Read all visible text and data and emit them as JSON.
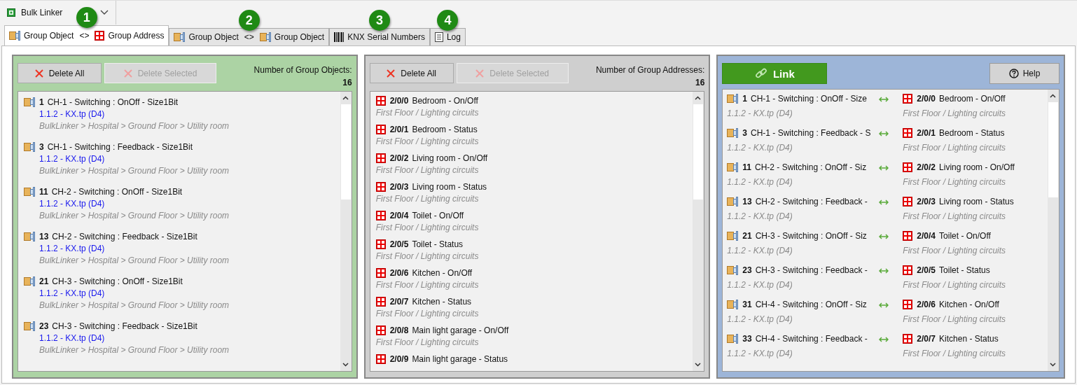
{
  "app_selector": {
    "label": "Bulk Linker"
  },
  "tabs": [
    {
      "selected": true,
      "badge": "1",
      "parts": [
        {
          "kind": "object",
          "text": "Group Object"
        },
        {
          "kind": "separator",
          "text": "<>"
        },
        {
          "kind": "address",
          "text": "Group Address"
        }
      ]
    },
    {
      "selected": false,
      "badge": "2",
      "parts": [
        {
          "kind": "object",
          "text": "Group Object"
        },
        {
          "kind": "separator",
          "text": "<>"
        },
        {
          "kind": "object",
          "text": "Group Object"
        }
      ]
    },
    {
      "selected": false,
      "badge": "3",
      "parts": [
        {
          "kind": "barcode",
          "text": "KNX Serial Numbers"
        }
      ]
    },
    {
      "selected": false,
      "badge": "4",
      "parts": [
        {
          "kind": "log",
          "text": "Log"
        }
      ]
    }
  ],
  "group_objects": {
    "buttons": [
      {
        "label": "Delete All",
        "disabled": false
      },
      {
        "label": "Delete Selected",
        "disabled": true
      }
    ],
    "count_label": "Number of Group Objects:",
    "count": "16",
    "items": [
      {
        "number": "1",
        "name": "CH-1 - Switching : OnOff - Size1Bit",
        "device": "1.1.2 - KX.tp (D4)",
        "path": "BulkLinker > Hospital > Ground Floor > Utility room"
      },
      {
        "number": "3",
        "name": "CH-1 - Switching : Feedback - Size1Bit",
        "device": "1.1.2 - KX.tp (D4)",
        "path": "BulkLinker > Hospital > Ground Floor > Utility room"
      },
      {
        "number": "11",
        "name": "CH-2 - Switching : OnOff - Size1Bit",
        "device": "1.1.2 - KX.tp (D4)",
        "path": "BulkLinker > Hospital > Ground Floor > Utility room"
      },
      {
        "number": "13",
        "name": "CH-2 - Switching : Feedback - Size1Bit",
        "device": "1.1.2 - KX.tp (D4)",
        "path": "BulkLinker > Hospital > Ground Floor > Utility room"
      },
      {
        "number": "21",
        "name": "CH-3 - Switching : OnOff - Size1Bit",
        "device": "1.1.2 - KX.tp (D4)",
        "path": "BulkLinker > Hospital > Ground Floor > Utility room"
      },
      {
        "number": "23",
        "name": "CH-3 - Switching : Feedback - Size1Bit",
        "device": "1.1.2 - KX.tp (D4)",
        "path": "BulkLinker > Hospital > Ground Floor > Utility room"
      }
    ]
  },
  "group_addresses": {
    "buttons": [
      {
        "label": "Delete All",
        "disabled": false
      },
      {
        "label": "Delete Selected",
        "disabled": true
      }
    ],
    "count_label": "Number of Group Addresses:",
    "count": "16",
    "items": [
      {
        "address": "2/0/0",
        "name": "Bedroom - On/Off",
        "path": "First Floor / Lighting circuits"
      },
      {
        "address": "2/0/1",
        "name": "Bedroom - Status",
        "path": "First Floor / Lighting circuits"
      },
      {
        "address": "2/0/2",
        "name": "Living room - On/Off",
        "path": "First Floor / Lighting circuits"
      },
      {
        "address": "2/0/3",
        "name": "Living room - Status",
        "path": "First Floor / Lighting circuits"
      },
      {
        "address": "2/0/4",
        "name": "Toilet - On/Off",
        "path": "First Floor / Lighting circuits"
      },
      {
        "address": "2/0/5",
        "name": "Toilet - Status",
        "path": "First Floor / Lighting circuits"
      },
      {
        "address": "2/0/6",
        "name": "Kitchen - On/Off",
        "path": "First Floor / Lighting circuits"
      },
      {
        "address": "2/0/7",
        "name": "Kitchen - Status",
        "path": "First Floor / Lighting circuits"
      },
      {
        "address": "2/0/8",
        "name": "Main light garage - On/Off",
        "path": "First Floor / Lighting circuits"
      },
      {
        "address": "2/0/9",
        "name": "Main light garage - Status"
      }
    ]
  },
  "links": {
    "link_button": "Link",
    "help_button": "Help",
    "items": [
      {
        "number": "1",
        "name": "CH-1 - Switching : OnOff - Size",
        "device": "1.1.2 - KX.tp (D4)",
        "address": "2/0/0",
        "ga_name": "Bedroom - On/Off",
        "path": "First Floor / Lighting circuits"
      },
      {
        "number": "3",
        "name": "CH-1 - Switching : Feedback - S",
        "device": "1.1.2 - KX.tp (D4)",
        "address": "2/0/1",
        "ga_name": "Bedroom - Status",
        "path": "First Floor / Lighting circuits"
      },
      {
        "number": "11",
        "name": "CH-2 - Switching : OnOff - Siz",
        "device": "1.1.2 - KX.tp (D4)",
        "address": "2/0/2",
        "ga_name": "Living room - On/Off",
        "path": "First Floor / Lighting circuits"
      },
      {
        "number": "13",
        "name": "CH-2 - Switching : Feedback -",
        "device": "1.1.2 - KX.tp (D4)",
        "address": "2/0/3",
        "ga_name": "Living room - Status",
        "path": "First Floor / Lighting circuits"
      },
      {
        "number": "21",
        "name": "CH-3 - Switching : OnOff - Siz",
        "device": "1.1.2 - KX.tp (D4)",
        "address": "2/0/4",
        "ga_name": "Toilet - On/Off",
        "path": "First Floor / Lighting circuits"
      },
      {
        "number": "23",
        "name": "CH-3 - Switching : Feedback -",
        "device": "1.1.2 - KX.tp (D4)",
        "address": "2/0/5",
        "ga_name": "Toilet - Status",
        "path": "First Floor / Lighting circuits"
      },
      {
        "number": "31",
        "name": "CH-4 - Switching : OnOff - Siz",
        "device": "1.1.2 - KX.tp (D4)",
        "address": "2/0/6",
        "ga_name": "Kitchen - On/Off",
        "path": "First Floor / Lighting circuits"
      },
      {
        "number": "33",
        "name": "CH-4 - Switching : Feedback -",
        "device": "1.1.2 - KX.tp (D4)",
        "address": "2/0/7",
        "ga_name": "Kitchen - Status",
        "path": "First Floor / Lighting circuits"
      }
    ]
  }
}
